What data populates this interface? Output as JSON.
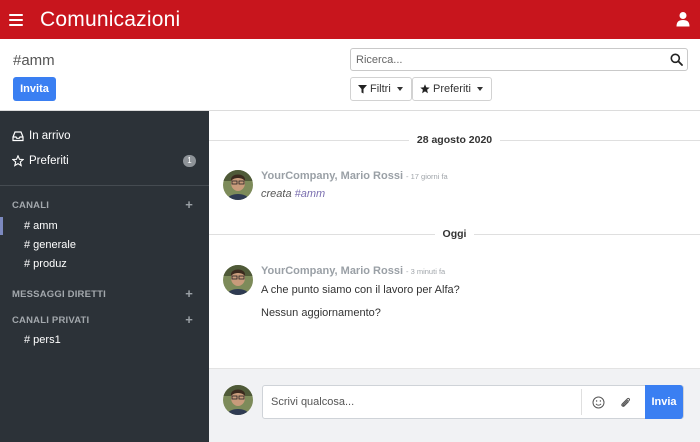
{
  "app": {
    "title": "Comunicazioni"
  },
  "icons": {
    "menu": "hamburger-icon",
    "user": "user-icon",
    "search": "search-icon",
    "filter": "funnel-icon",
    "star": "star-icon",
    "inbox": "inbox-icon",
    "emoji": "smiley-icon",
    "attach": "paperclip-icon"
  },
  "colors": {
    "topbar": "#c8151d",
    "primary": "#3a7ff2",
    "sidebar": "#2c3238"
  },
  "control": {
    "channel_title": "#amm",
    "invite_label": "Invita",
    "search_placeholder": "Ricerca...",
    "filters_label": "Filtri",
    "favorites_label": "Preferiti"
  },
  "sidebar": {
    "inbox_label": "In arrivo",
    "starred_label": "Preferiti",
    "starred_count": "1",
    "channels_heading": "CANALI",
    "channels": [
      "# amm",
      "# generale",
      "# produz"
    ],
    "direct_heading": "MESSAGGI DIRETTI",
    "private_heading": "CANALI PRIVATI",
    "private_channels": [
      "# pers1"
    ],
    "add_symbol": "+"
  },
  "thread": {
    "separators": [
      "28 agosto 2020",
      "Oggi"
    ],
    "messages": [
      {
        "author": "YourCompany, Mario Rossi",
        "time": "- 17 giorni fa",
        "lines": [
          "creata "
        ],
        "channel_ref": "#amm"
      },
      {
        "author": "YourCompany, Mario Rossi",
        "time": "- 3 minuti fa",
        "lines": [
          "A che punto siamo con il lavoro per Alfa?",
          "Nessun aggiornamento?"
        ]
      }
    ]
  },
  "composer": {
    "placeholder": "Scrivi qualcosa...",
    "send_label": "Invia"
  }
}
